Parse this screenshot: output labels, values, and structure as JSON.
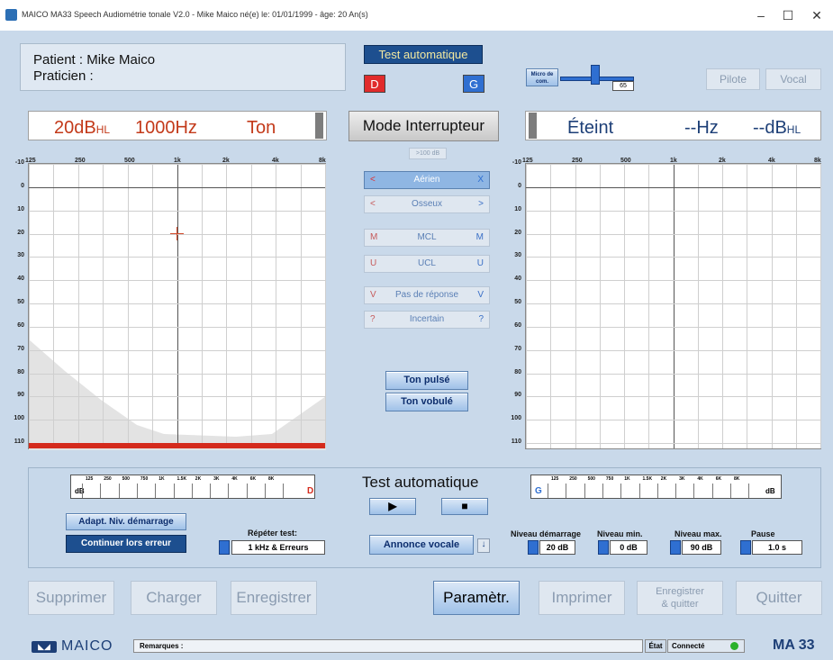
{
  "window": {
    "title": "MAICO MA33 Speech Audiométrie tonale V2.0 - Mike Maico   né(e) le: 01/01/1999 - âge: 20 An(s)",
    "minimize": "–",
    "maximize": "☐",
    "close": "✕"
  },
  "patient": {
    "patient_line": "Patient   : Mike Maico",
    "praticien_line": "Praticien :"
  },
  "header": {
    "test_auto": "Test automatique",
    "left_ear": "D",
    "right_ear": "G",
    "micro_label": "Micro de com.",
    "micro_value": "65",
    "pilote": "Pilote",
    "vocal": "Vocal"
  },
  "left_display": {
    "level": "20dB",
    "unit": "HL",
    "freq": "1000Hz",
    "signal": "Ton"
  },
  "mode_button": "Mode Interrupteur",
  "right_display": {
    "state": "Éteint",
    "freq": "--Hz",
    "level": "--dB",
    "unit": "HL"
  },
  "audiogram": {
    "freqs": [
      "125",
      "250",
      "500",
      "1k",
      "2k",
      "4k",
      "8k"
    ],
    "db_levels": [
      "-10",
      "0",
      "10",
      "20",
      "30",
      "40",
      "50",
      "60",
      "70",
      "80",
      "90",
      "100",
      "110"
    ]
  },
  "middle_controls": {
    "over100": ">100 dB",
    "aerien": "Aérien",
    "aerien_l": "<",
    "aerien_r": "X",
    "osseux": "Osseux",
    "osseux_l": "<",
    "osseux_r": ">",
    "mcl": "MCL",
    "mcl_l": "M",
    "mcl_r": "M",
    "ucl": "UCL",
    "ucl_l": "U",
    "ucl_r": "U",
    "pas_reponse": "Pas de réponse",
    "pas_reponse_l": "V",
    "pas_reponse_r": "V",
    "incertain": "Incertain",
    "incertain_l": "?",
    "incertain_r": "?",
    "ton_pulse": "Ton pulsé",
    "ton_vobule": "Ton vobulé"
  },
  "bottom": {
    "freq_labels": [
      "125",
      "250",
      "500",
      "750",
      "1K",
      "1.5K",
      "2K",
      "3K",
      "4K",
      "6K",
      "8K"
    ],
    "left_db": "dB",
    "left_ear": "D",
    "right_ear": "G",
    "right_db": "dB",
    "adapt_btn": "Adapt. Niv. démarrage",
    "continuer_btn": "Continuer lors erreur",
    "repeter_label": "Répéter test:",
    "repeter_value": "1 kHz & Erreurs",
    "test_auto_title": "Test automatique",
    "play": "▶",
    "stop": "■",
    "annonce_btn": "Annonce vocale",
    "niveau_demarrage_label": "Niveau démarrage",
    "niveau_demarrage_value": "20 dB",
    "niveau_min_label": "Niveau min.",
    "niveau_min_value": "0 dB",
    "niveau_max_label": "Niveau max.",
    "niveau_max_value": "90 dB",
    "pause_label": "Pause",
    "pause_value": "1.0 s"
  },
  "actions": {
    "supprimer": "Supprimer",
    "charger": "Charger",
    "enregistrer": "Enregistrer",
    "parametr": "Paramètr.",
    "imprimer": "Imprimer",
    "enregistrer_quitter_1": "Enregistrer",
    "enregistrer_quitter_2": "& quitter",
    "quitter": "Quitter"
  },
  "footer": {
    "brand": "MAICO",
    "remarks": "Remarques :",
    "etat_label": "État",
    "etat_value": "Connecté",
    "model": "MA 33"
  },
  "colors": {
    "accent_red": "#c33a1a",
    "accent_blue": "#1d4f8f",
    "status_green": "#2bb12b"
  }
}
